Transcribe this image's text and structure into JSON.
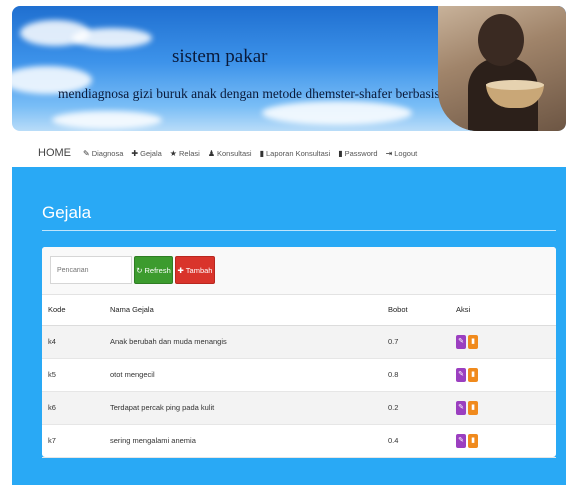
{
  "banner": {
    "title": "sistem pakar",
    "subtitle": "mendiagnosa gizi buruk anak dengan metode dhemster-shafer berbasis web"
  },
  "nav": {
    "home": "HOME",
    "items": [
      {
        "label": "Diagnosa",
        "icon": "pencil-icon",
        "glyph": "✎"
      },
      {
        "label": "Gejala",
        "icon": "plus-icon",
        "glyph": "✚"
      },
      {
        "label": "Relasi",
        "icon": "star-icon",
        "glyph": "★"
      },
      {
        "label": "Konsultasi",
        "icon": "users-icon",
        "glyph": "♟"
      },
      {
        "label": "Laporan Konsultasi",
        "icon": "file-icon",
        "glyph": "▮"
      },
      {
        "label": "Password",
        "icon": "lock-icon",
        "glyph": "▮"
      },
      {
        "label": "Logout",
        "icon": "logout-icon",
        "glyph": "⇥"
      }
    ]
  },
  "page": {
    "title": "Gejala"
  },
  "toolbar": {
    "search_placeholder": "Pencarian",
    "refresh_label": "Refresh",
    "tambah_label": "Tambah"
  },
  "table": {
    "headers": [
      "Kode",
      "Nama Gejala",
      "Bobot",
      "Aksi"
    ],
    "rows": [
      {
        "kode": "k4",
        "nama": "Anak berubah dan muda menangis",
        "bobot": "0.7"
      },
      {
        "kode": "k5",
        "nama": "otot mengecil",
        "bobot": "0.8"
      },
      {
        "kode": "k6",
        "nama": "Terdapat percak ping pada kulit",
        "bobot": "0.2"
      },
      {
        "kode": "k7",
        "nama": "sering mengalami anemia",
        "bobot": "0.4"
      }
    ]
  },
  "colors": {
    "content_bg": "#29a9f5",
    "refresh": "#3c9b2e",
    "tambah": "#d9342b",
    "edit": "#9b3fc0",
    "delete": "#f08a1d"
  }
}
